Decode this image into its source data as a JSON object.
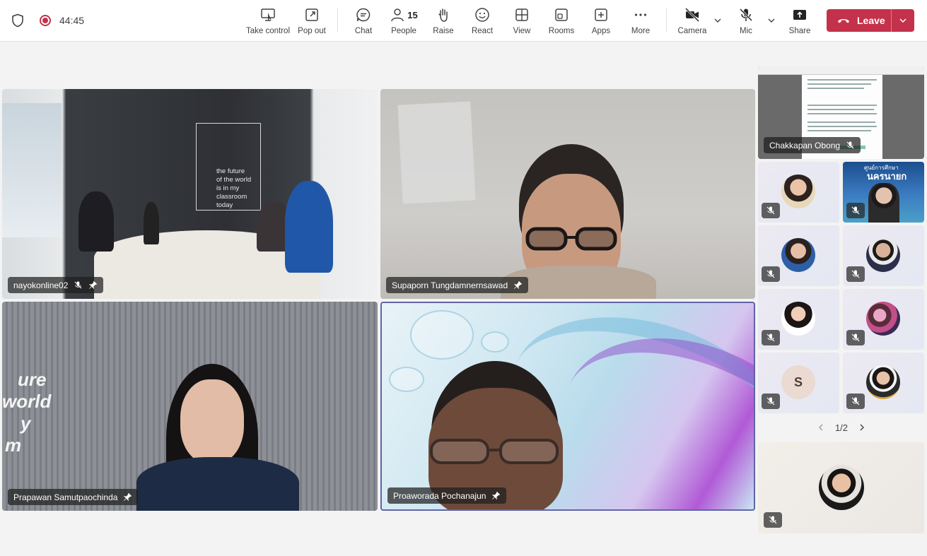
{
  "meeting": {
    "timer": "44:45"
  },
  "toolbar": {
    "take_control": "Take control",
    "pop_out": "Pop out",
    "chat": "Chat",
    "people": "People",
    "people_count": "15",
    "raise": "Raise",
    "react": "React",
    "view": "View",
    "rooms": "Rooms",
    "apps": "Apps",
    "more": "More",
    "camera": "Camera",
    "mic": "Mic",
    "share": "Share",
    "leave": "Leave"
  },
  "stage": {
    "tiles": [
      {
        "name": "nayokonline02",
        "muted": true,
        "pinned": true
      },
      {
        "name": "Supaporn Tungdamnernsawad",
        "muted": false,
        "pinned": true
      },
      {
        "name": "Prapawan Samutpaochinda",
        "muted": false,
        "pinned": true
      },
      {
        "name": "Proaworada Pochanajun",
        "muted": false,
        "pinned": true,
        "speaking": true
      }
    ],
    "wall_sign": [
      "the future",
      "of the world",
      "is in my",
      "classroom",
      "today"
    ],
    "wall_text": [
      "ure",
      "world",
      "y",
      "m"
    ]
  },
  "sidebar": {
    "presenter": {
      "name": "Chakkapan Obong"
    },
    "thumb_banner": [
      "ศูนย์การศึกษา",
      "นครนายก"
    ],
    "letter_avatar": "S",
    "pager": "1/2"
  },
  "colors": {
    "accent": "#6264a7",
    "leave": "#c4314b",
    "record": "#c4314b"
  }
}
